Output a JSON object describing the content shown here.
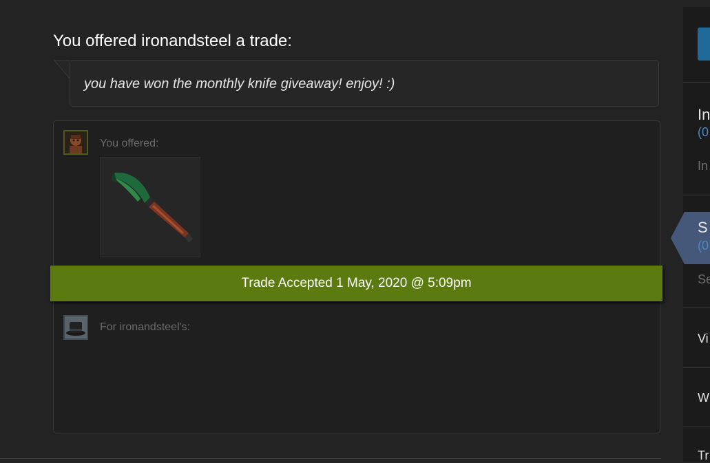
{
  "message": {
    "heading": "You offered ironandsteel a trade:",
    "note": "you have won the monthly knife giveaway! enjoy! :)"
  },
  "trade": {
    "you_label": "You offered:",
    "them_label": "For ironandsteel's:",
    "status": "Trade Accepted 1 May, 2020 @ 5:09pm",
    "status_color": "#5b7b10"
  },
  "sidebar": {
    "incoming": {
      "title": "In",
      "count": "(0",
      "sub": "In"
    },
    "sent": {
      "title": "S",
      "count": "(0",
      "sub": "Se"
    },
    "links": [
      "Vi",
      "W",
      "Tr"
    ],
    "accent_color": "#1f6a99"
  }
}
